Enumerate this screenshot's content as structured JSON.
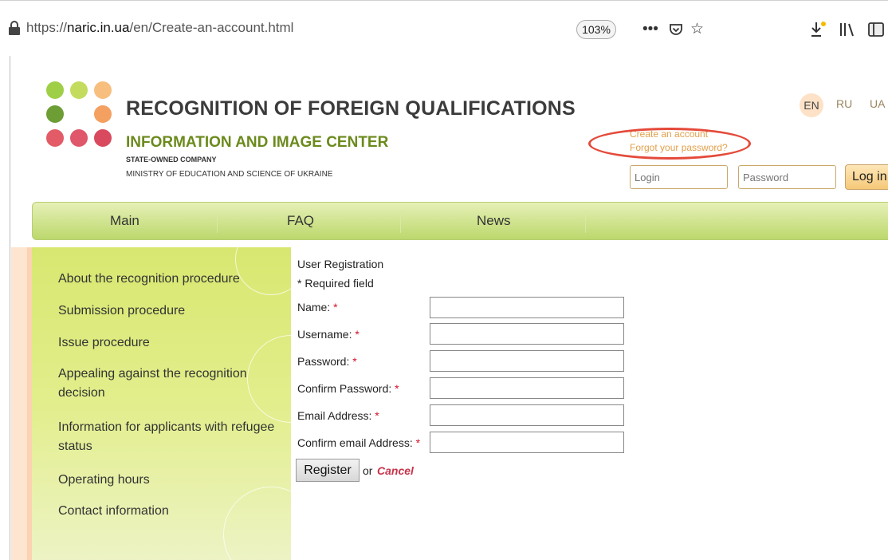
{
  "browser": {
    "url_prefix": "https://",
    "url_domain": "naric.in.ua",
    "url_path": "/en/Create-an-account.html",
    "zoom": "103%",
    "more_icon": "more-horizontal-icon",
    "pocket_icon": "pocket-icon",
    "bookmark_icon": "star-icon",
    "download_icon": "download-icon",
    "library_icon": "library-icon",
    "sidebar_icon": "sidebar-icon"
  },
  "header": {
    "title": "RECOGNITION OF FOREIGN QUALIFICATIONS",
    "subtitle": "INFORMATION AND IMAGE CENTER",
    "company": "STATE-OWNED COMPANY",
    "ministry": "MINISTRY OF EDUCATION AND SCIENCE OF UKRAINE",
    "logo_colors": [
      "#9fcf47",
      "#b7d957",
      "#f6b37b",
      "#6d9d35",
      "#f4a060",
      "#e25b66",
      "#e0566a",
      "#d94a5e"
    ]
  },
  "languages": [
    "EN",
    "RU",
    "UA"
  ],
  "account": {
    "create_link": "Create an account",
    "forgot_link": "Forgot your password?",
    "login_placeholder": "Login",
    "password_placeholder": "Password",
    "login_button": "Log in"
  },
  "nav": {
    "items": [
      "Main",
      "FAQ",
      "News"
    ]
  },
  "sidebar": {
    "items": [
      "About the recognition procedure",
      "Submission procedure",
      "Issue procedure",
      "Appealing against the recognition decision",
      "Information for applicants with refugee status",
      "Operating hours",
      "Contact information"
    ]
  },
  "form": {
    "heading": "User Registration",
    "required_note": "* Required field",
    "required_marker": "*",
    "fields": [
      "Name:",
      "Username:",
      "Password:",
      "Confirm Password:",
      "Email Address:",
      "Confirm email Address:"
    ],
    "register_button": "Register",
    "or_text": "or",
    "cancel_link": "Cancel"
  },
  "colors": {
    "accent_green": "#6b8a1c",
    "link_orange": "#e2a04a",
    "required_red": "#d0132b",
    "cancel_red": "#c8334a",
    "highlight_circle": "#e44a3a"
  }
}
